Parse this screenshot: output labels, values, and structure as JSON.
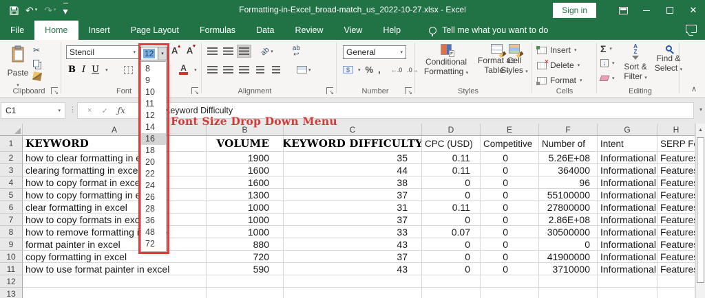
{
  "colors": {
    "accent_green": "#217346",
    "annotation_red": "#d43a3a",
    "highlight_box_red": "#e23b3b",
    "size_selection_blue": "#79aede"
  },
  "titlebar": {
    "title": "Formatting-in-Excel_broad-match_us_2022-10-27.xlsx - Excel",
    "sign_in": "Sign in"
  },
  "tabs": {
    "items": [
      "File",
      "Home",
      "Insert",
      "Page Layout",
      "Formulas",
      "Data",
      "Review",
      "View",
      "Help"
    ],
    "active": "Home",
    "tell_me": "Tell me what you want to do"
  },
  "ribbon": {
    "clipboard": {
      "label": "Clipboard",
      "paste": "Paste"
    },
    "font": {
      "label": "Font",
      "font_name": "Stencil",
      "font_size": "12"
    },
    "alignment": {
      "label": "Alignment"
    },
    "number": {
      "label": "Number",
      "format": "General"
    },
    "styles": {
      "label": "Styles",
      "conditional_formatting": [
        "Conditional",
        "Formatting"
      ],
      "format_as_table": [
        "Format as",
        "Table"
      ],
      "cell_styles": [
        "Cell",
        "Styles"
      ]
    },
    "cells": {
      "label": "Cells",
      "insert": "Insert",
      "delete": "Delete",
      "format": "Format"
    },
    "editing": {
      "label": "Editing",
      "sort_filter": [
        "Sort &",
        "Filter"
      ],
      "find_select": [
        "Find &",
        "Select"
      ]
    }
  },
  "formula_bar": {
    "name_box": "C1",
    "value": "Keyword Difficulty"
  },
  "annotation": {
    "label": "Font Size Drop Down Menu"
  },
  "font_size_dropdown": {
    "current": "12",
    "highlighted": "16",
    "sizes": [
      "8",
      "9",
      "10",
      "11",
      "12",
      "14",
      "16",
      "18",
      "20",
      "22",
      "24",
      "26",
      "28",
      "36",
      "48",
      "72"
    ]
  },
  "grid": {
    "columns": [
      "A",
      "B",
      "C",
      "D",
      "E",
      "F",
      "G",
      "H"
    ],
    "headers": {
      "keyword": "KEYWORD",
      "volume": "VOLUME",
      "difficulty": "KEYWORD DIFFICULTY",
      "cpc": "CPC (USD)",
      "competitive": "Competitive",
      "number_of": "Number of",
      "intent": "Intent",
      "serp": "SERP Features"
    },
    "rows": [
      [
        "how to clear formatting in excel",
        "1900",
        "35",
        "0.11",
        "0",
        "5.26E+08",
        "Informational",
        "Features"
      ],
      [
        "clearing formatting in excel",
        "1600",
        "44",
        "0.11",
        "0",
        "364000",
        "Informational",
        "Features"
      ],
      [
        "how to copy format in excel",
        "1600",
        "38",
        "0",
        "0",
        "96",
        "Informational",
        "Features"
      ],
      [
        "how to copy formatting in excel",
        "1300",
        "37",
        "0",
        "0",
        "55100000",
        "Informational",
        "Features"
      ],
      [
        "clear formatting in excel",
        "1000",
        "31",
        "0.11",
        "0",
        "27800000",
        "Informational",
        "Features"
      ],
      [
        "how to copy formats in excel",
        "1000",
        "37",
        "0",
        "0",
        "2.86E+08",
        "Informational",
        "Features"
      ],
      [
        "how to remove formatting in excel",
        "1000",
        "33",
        "0.07",
        "0",
        "30500000",
        "Informational",
        "Features"
      ],
      [
        "format painter in excel",
        "880",
        "43",
        "0",
        "0",
        "0",
        "Informational",
        "Features"
      ],
      [
        "copy formatting in excel",
        "720",
        "37",
        "0",
        "0",
        "41900000",
        "Informational",
        "Features"
      ],
      [
        "how to use format painter in excel",
        "590",
        "43",
        "0",
        "0",
        "3710000",
        "Informational",
        "Features"
      ]
    ],
    "row_numbers": [
      "1",
      "2",
      "3",
      "4",
      "5",
      "6",
      "7",
      "8",
      "9",
      "10",
      "11",
      "12",
      "13"
    ]
  },
  "icons": {
    "caret": "▾",
    "undo": "↶",
    "redo": "↷",
    "bold": "B",
    "italic": "I",
    "underline": "U",
    "grow_font": "A",
    "shrink_font": "A",
    "font_color": "A",
    "scissors": "✂",
    "orientation": "ab",
    "wrap_text": "ab",
    "wrap_arrow": "↩",
    "accounting": "$",
    "percent": "%",
    "comma": ",",
    "inc_decimal": "←.0",
    "dec_decimal": ".0→",
    "autosum": "Σ",
    "fill_down": "↓",
    "sort_a": "A",
    "sort_z": "Z",
    "collapse_ribbon": "∧",
    "cancel": "×",
    "enter": "✓",
    "fx": "ƒx",
    "name_dots": "⋮",
    "scroll_up": "▲",
    "resize_dots": "·····",
    "minimize": "—",
    "close": "✕"
  }
}
